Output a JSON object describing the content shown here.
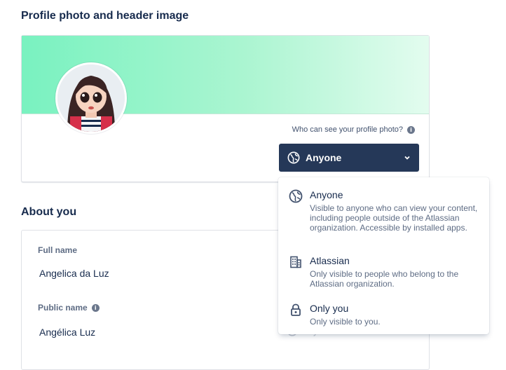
{
  "profile_section": {
    "title": "Profile photo and header image",
    "visibility_question": "Who can see your profile photo?",
    "visibility_selected": "Anyone"
  },
  "about_section": {
    "title": "About you",
    "fields": [
      {
        "label": "Full name",
        "value": "Angelica da Luz"
      },
      {
        "label": "Public name",
        "value": "Angélica Luz",
        "faded_visibility": "Anyone"
      }
    ]
  },
  "visibility_menu": {
    "options": [
      {
        "title": "Anyone",
        "description": "Visible to anyone who can view your content, including people outside of the Atlassian organization. Accessible by installed apps.",
        "icon": "globe-icon"
      },
      {
        "title": "Atlassian",
        "description": "Only visible to people who belong to the Atlassian organization.",
        "icon": "building-icon"
      },
      {
        "title": "Only you",
        "description": "Only visible to you.",
        "icon": "lock-icon"
      }
    ]
  },
  "colors": {
    "button_bg": "#253858",
    "header_gradient_start": "#79f2c0",
    "header_gradient_end": "#e3fcef",
    "text_primary": "#172b4d",
    "text_subtle": "#5e6c84"
  }
}
